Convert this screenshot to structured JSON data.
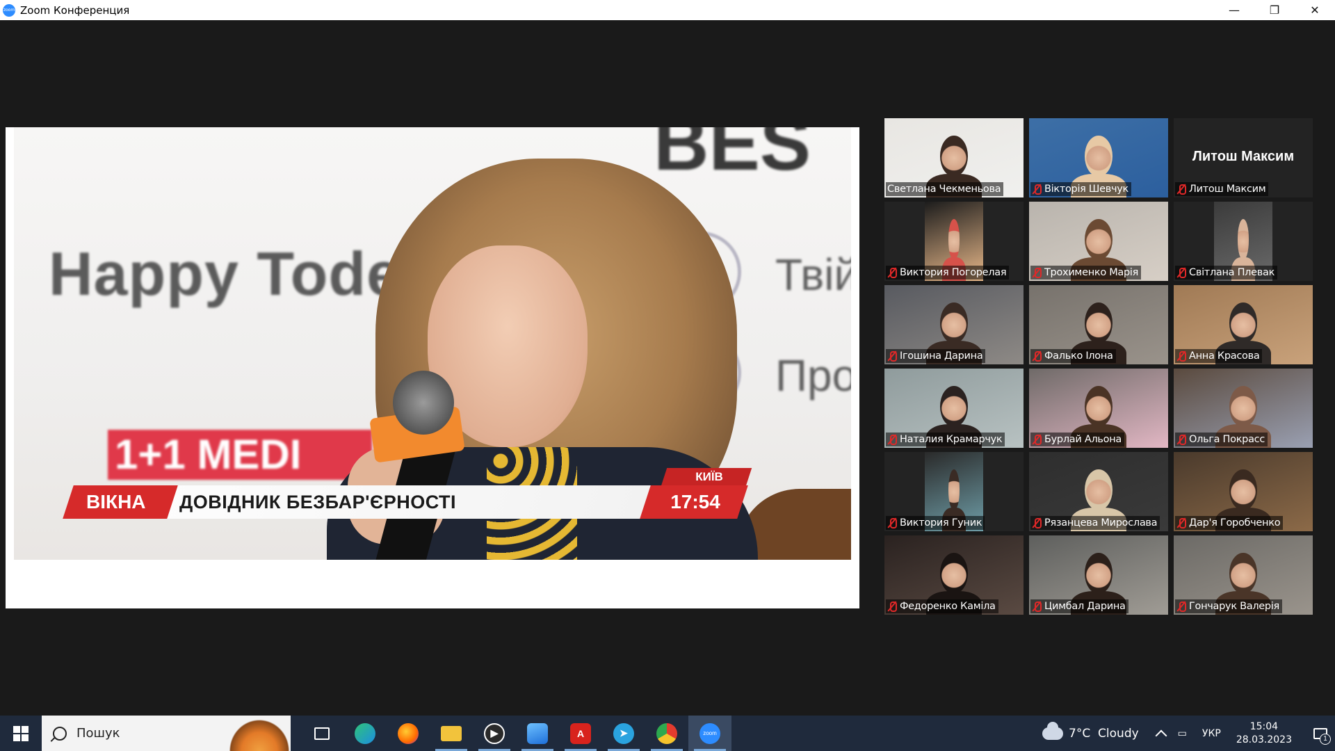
{
  "window": {
    "title": "Zoom Конференция",
    "app_icon": "zoom",
    "controls": {
      "minimize": "—",
      "maximize": "❐",
      "close": "✕"
    }
  },
  "share_screen": {
    "background_texts": {
      "happy": "Happy Tode",
      "best": "BES",
      "tvii": "Твій",
      "pro": "Про"
    },
    "media_logo": "1+1 MEDI",
    "lower_third": {
      "channel": "ВІКНА",
      "title": "ДОВІДНИК БЕЗБАР'ЄРНОСТІ",
      "city": "КИЇВ",
      "time": "17:54"
    }
  },
  "gallery": {
    "participants": [
      {
        "name": "Светлана Чекменьова",
        "muted": false,
        "active_speaker": true,
        "video": true
      },
      {
        "name": "Вікторія Шевчук",
        "muted": true,
        "active_speaker": false,
        "video": true
      },
      {
        "name": "Литош Максим",
        "muted": true,
        "active_speaker": false,
        "video": false,
        "display_name": "Литош Максим"
      },
      {
        "name": "Виктория Погорелая",
        "muted": true,
        "active_speaker": false,
        "video": true
      },
      {
        "name": "Трохименко Марія",
        "muted": true,
        "active_speaker": false,
        "video": true
      },
      {
        "name": "Світлана Плевак",
        "muted": true,
        "active_speaker": false,
        "video": true
      },
      {
        "name": "Ігошина Дарина",
        "muted": true,
        "active_speaker": false,
        "video": true
      },
      {
        "name": "Фалько Ілона",
        "muted": true,
        "active_speaker": false,
        "video": true
      },
      {
        "name": "Анна Красова",
        "muted": true,
        "active_speaker": false,
        "video": true
      },
      {
        "name": "Наталия Крамарчук",
        "muted": true,
        "active_speaker": false,
        "video": true
      },
      {
        "name": "Бурлай Альона",
        "muted": true,
        "active_speaker": false,
        "video": true
      },
      {
        "name": "Ольга Покрасс",
        "muted": true,
        "active_speaker": false,
        "video": true
      },
      {
        "name": "Виктория Гуник",
        "muted": true,
        "active_speaker": false,
        "video": true
      },
      {
        "name": "Рязанцева Мирослава",
        "muted": true,
        "active_speaker": false,
        "video": true
      },
      {
        "name": "Дар'я Горобченко",
        "muted": true,
        "active_speaker": false,
        "video": true
      },
      {
        "name": "Федоренко Каміла",
        "muted": true,
        "active_speaker": false,
        "video": true
      },
      {
        "name": "Цимбал Дарина",
        "muted": true,
        "active_speaker": false,
        "video": true
      },
      {
        "name": "Гончарук Валерія",
        "muted": true,
        "active_speaker": false,
        "video": true
      }
    ]
  },
  "taskbar": {
    "search_placeholder": "Пошук",
    "apps": [
      {
        "name": "task-view",
        "icon": "task-view-icon"
      },
      {
        "name": "edge",
        "icon": "edge-icon"
      },
      {
        "name": "firefox",
        "icon": "firefox-icon"
      },
      {
        "name": "file-explorer",
        "icon": "folder-icon"
      },
      {
        "name": "media-player",
        "icon": "play-icon"
      },
      {
        "name": "photos",
        "icon": "photos-icon"
      },
      {
        "name": "acrobat",
        "icon": "pdf-icon"
      },
      {
        "name": "telegram",
        "icon": "telegram-icon"
      },
      {
        "name": "chrome",
        "icon": "chrome-icon"
      },
      {
        "name": "zoom",
        "icon": "zoom-icon"
      }
    ],
    "weather": {
      "temp": "7°C",
      "condition": "Cloudy"
    },
    "language": "УКР",
    "time": "15:04",
    "date": "28.03.2023",
    "notifications": "1"
  },
  "colors": {
    "meeting_bg": "#1a1a1a",
    "active_speaker_border": "#c7e23a",
    "muted_icon": "#e02828",
    "taskbar_bg": "#1f2a3c",
    "zoom_blue": "#2d8cff"
  }
}
